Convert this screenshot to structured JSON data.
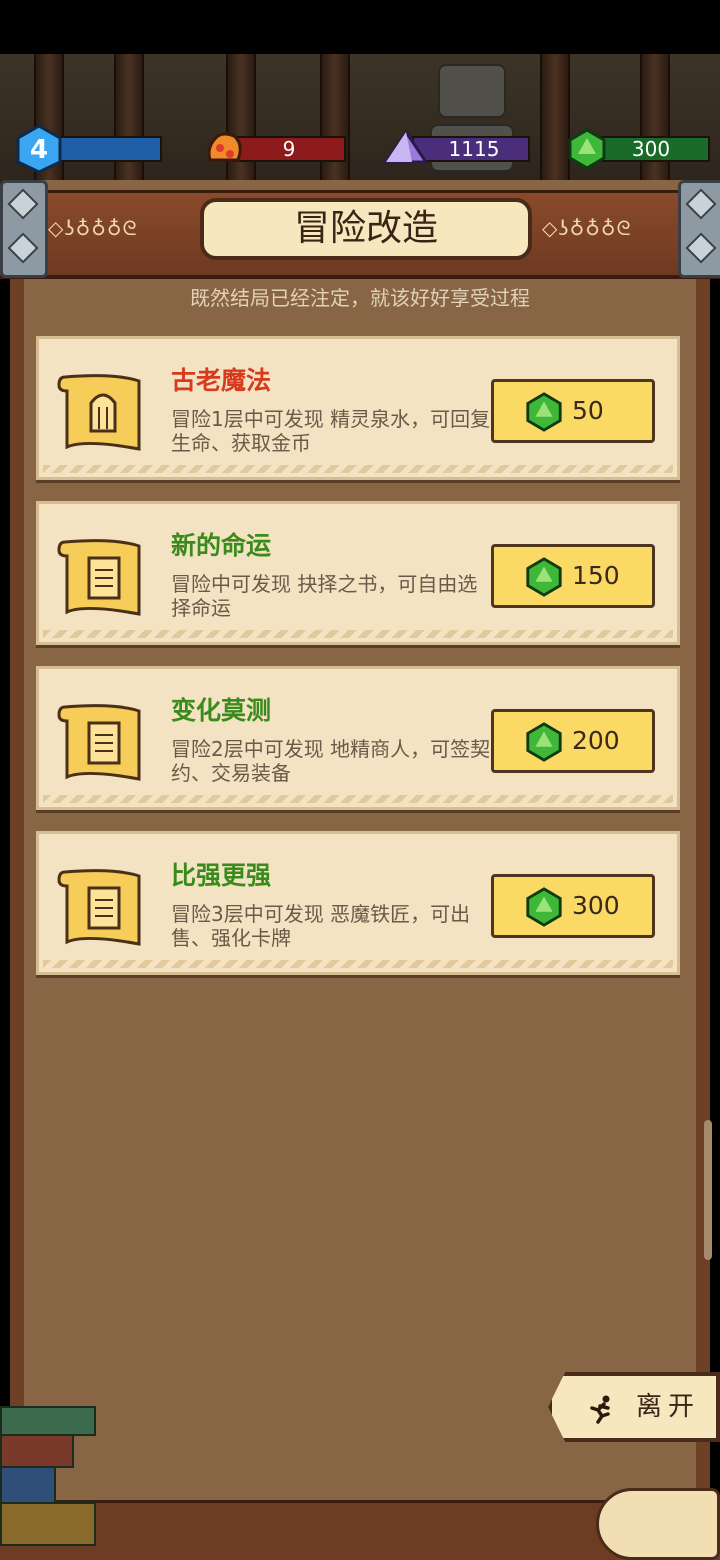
{
  "hud": {
    "level": "4",
    "fire": "9",
    "crystal": "1115",
    "gem": "300",
    "colors": {
      "level_bar": "#1f5fa8",
      "fire_bar": "#8e1b1b",
      "crystal_bar": "#4a2e7c",
      "gem_bar": "#1a6b2a"
    }
  },
  "header": {
    "title": "冒险改造",
    "subtitle": "既然结局已经注定，就该好好享受过程",
    "ornament_left": "◇ʖ♁♁♁ᘓ",
    "ornament_right": "◇ʖ♁♁♁ᘓ"
  },
  "cards": [
    {
      "name": "古老魔法",
      "name_color": "#d83a1e",
      "desc": "冒险1层中可发现 精灵泉水，可回复生命、获取金币",
      "price": "50",
      "icon": "fountain-scroll-icon"
    },
    {
      "name": "新的命运",
      "name_color": "#3a8a1c",
      "desc": "冒险中可发现 抉择之书，可自由选择命运",
      "price": "150",
      "icon": "book-scroll-icon"
    },
    {
      "name": "变化莫测",
      "name_color": "#3a8a1c",
      "desc": "冒险2层中可发现 地精商人，可签契约、交易装备",
      "price": "200",
      "icon": "book-scroll-icon"
    },
    {
      "name": "比强更强",
      "name_color": "#3a8a1c",
      "desc": "冒险3层中可发现 恶魔铁匠，可出售、强化卡牌",
      "price": "300",
      "icon": "book-scroll-icon"
    }
  ],
  "footer": {
    "leave_label": "离开",
    "leave_icon": "running-man-icon"
  }
}
